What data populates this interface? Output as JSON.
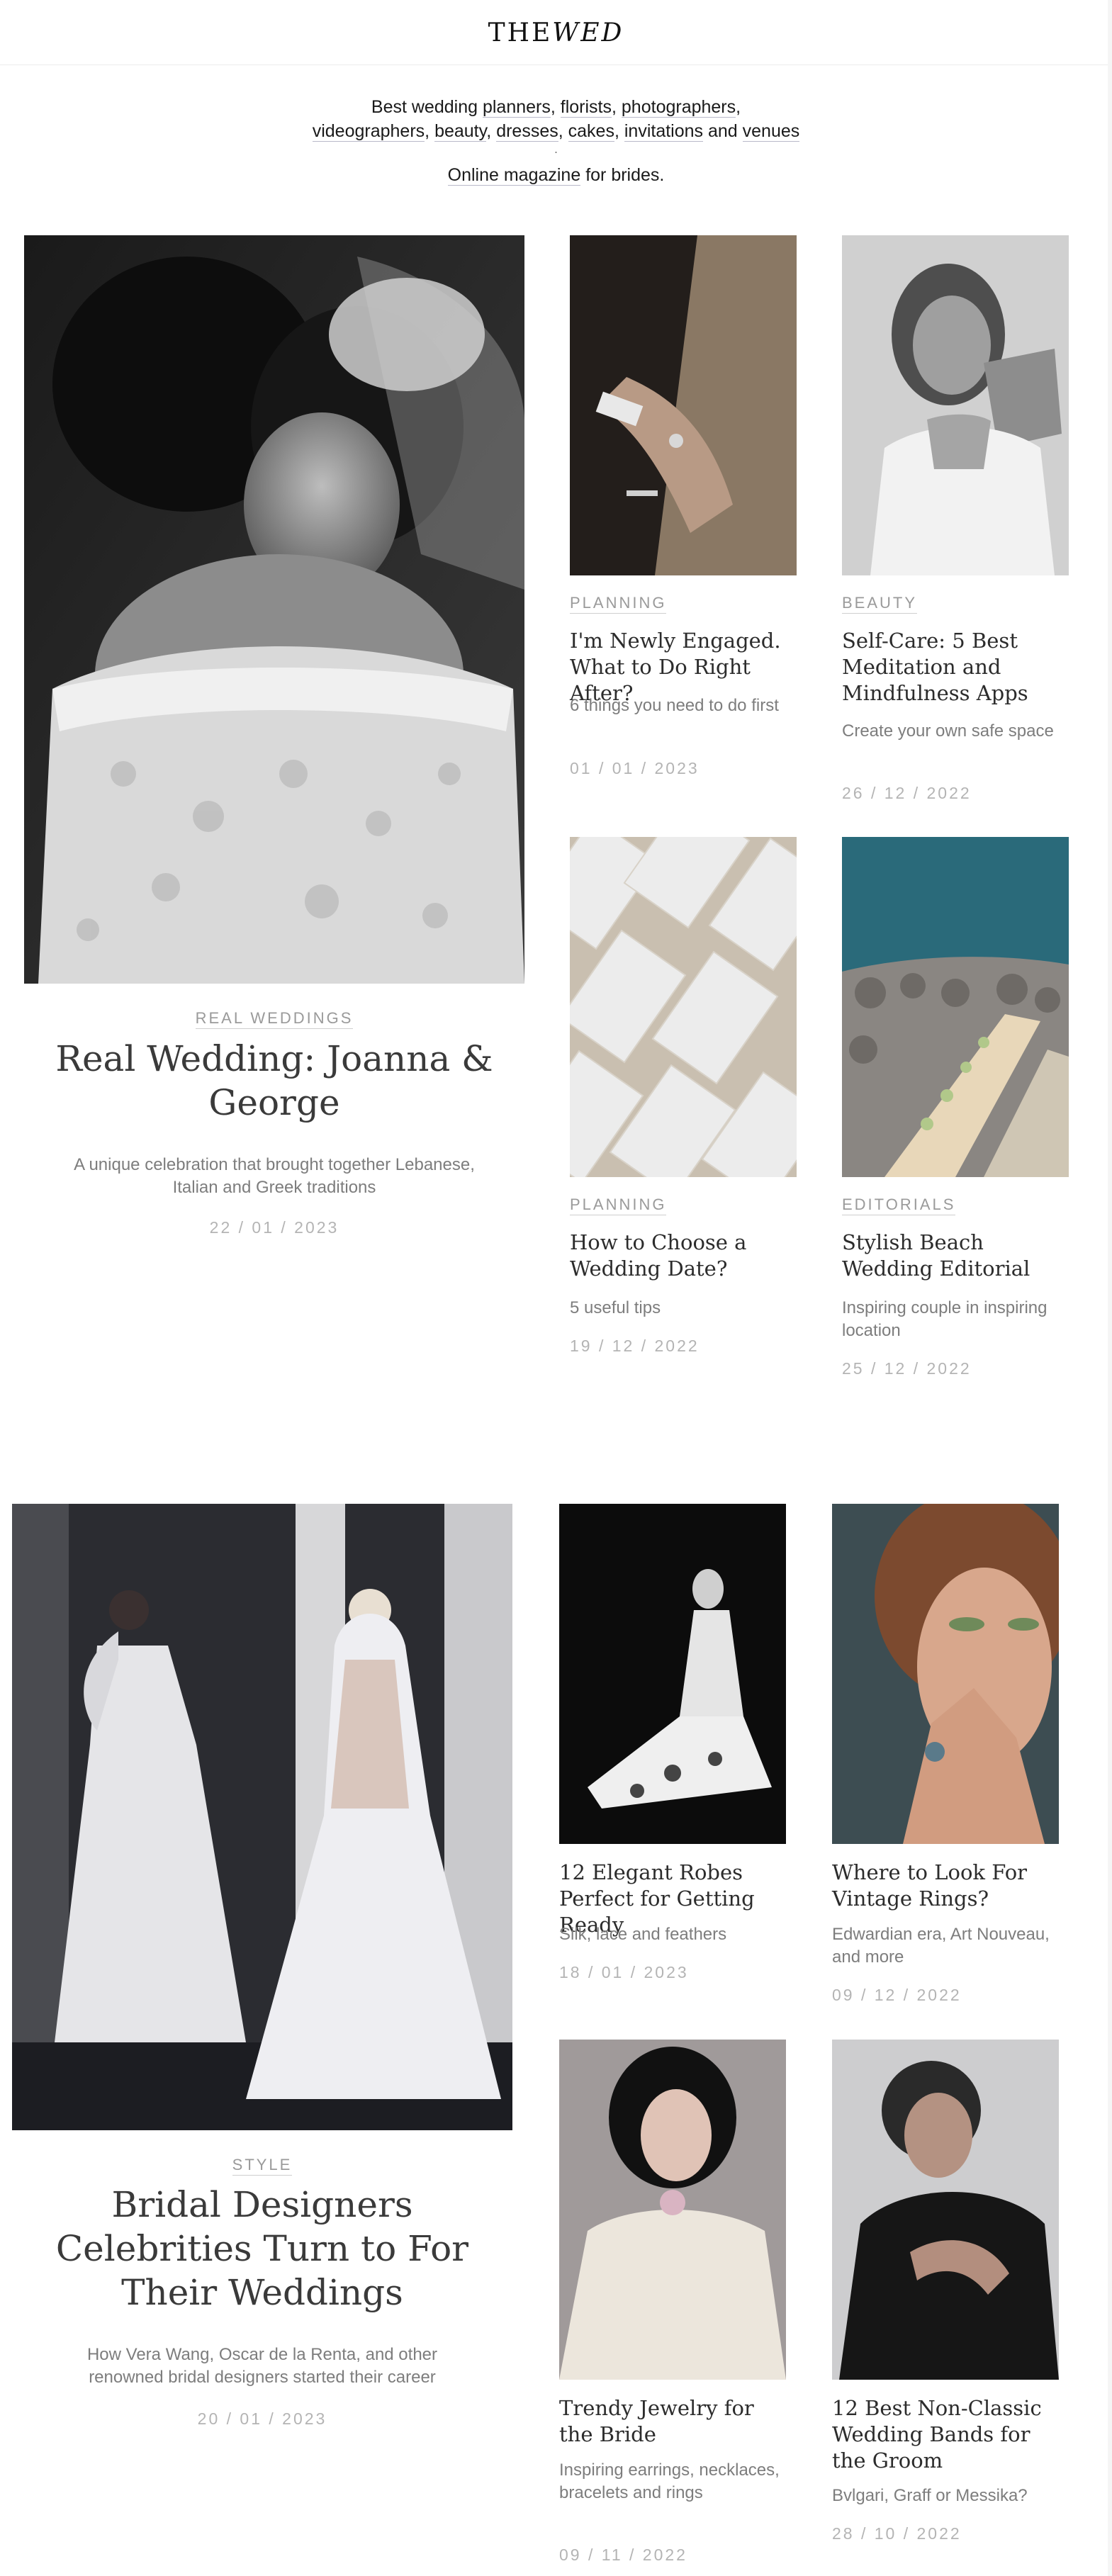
{
  "header": {
    "logo_a": "THE ",
    "logo_b": "WED"
  },
  "intro": {
    "prefix": "Best wedding ",
    "links": [
      "planners",
      "florists",
      "photographers",
      "videographers",
      "beauty",
      "dresses",
      "cakes",
      "invitations",
      "venues"
    ],
    "and": "and",
    "dot": ".",
    "magazine_link": "Online magazine",
    "magazine_suffix": " for brides."
  },
  "section1": {
    "feature": {
      "category": "REAL WEDDINGS",
      "title": "Real Wedding: Joanna & George",
      "subtitle": "A unique celebration that brought together Lebanese, Italian and Greek traditions",
      "date": "22 / 01 / 2023"
    },
    "cards": [
      {
        "category": "PLANNING",
        "title": "I'm Newly Engaged. What to Do Right After?",
        "subtitle": "6 things you need to do first",
        "date": "01 / 01 / 2023"
      },
      {
        "category": "BEAUTY",
        "title": "Self-Care: 5 Best Meditation and Mindfulness Apps",
        "subtitle": "Create your own safe space",
        "date": "26 / 12 / 2022"
      },
      {
        "category": "PLANNING",
        "title": "How to Choose a Wedding Date?",
        "subtitle": "5 useful tips",
        "date": "19 / 12 / 2022"
      },
      {
        "category": "EDITORIALS",
        "title": "Stylish Beach Wedding Editorial",
        "subtitle": "Inspiring couple in inspiring location",
        "date": "25 / 12 / 2022"
      }
    ]
  },
  "section2": {
    "feature": {
      "category": "STYLE",
      "title": "Bridal Designers Celebrities Turn to For Their Weddings",
      "subtitle": "How Vera Wang, Oscar de la Renta, and other renowned bridal designers started their career",
      "date": "20 / 01 / 2023"
    },
    "cards": [
      {
        "title": "12 Elegant Robes Perfect for Getting Ready",
        "subtitle": "Silk, lace and feathers",
        "date": "18 / 01 / 2023"
      },
      {
        "title": "Where to Look For Vintage Rings?",
        "subtitle": "Edwardian era, Art Nouveau, and more",
        "date": "09 / 12 / 2022"
      },
      {
        "title": "Trendy Jewelry for the Bride",
        "subtitle": "Inspiring earrings, necklaces, bracelets and rings",
        "date": "09 / 11 / 2022"
      },
      {
        "title": "12 Best Non-Classic Wedding Bands for the Groom",
        "subtitle": "Bvlgari, Graff or Messika?",
        "date": "28 / 10 / 2022"
      }
    ]
  }
}
